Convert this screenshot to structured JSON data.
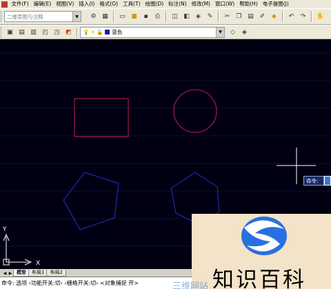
{
  "menu": {
    "items": [
      "文件(F)",
      "编辑(E)",
      "视图(V)",
      "插入(I)",
      "格式(O)",
      "工具(T)",
      "绘图(D)",
      "标注(N)",
      "修改(M)",
      "窗口(W)",
      "帮助(H)",
      "电子提图(J)"
    ]
  },
  "toolbar": {
    "workspace_combo": "二维草图与注释",
    "layer_combo": "蓝色"
  },
  "canvas": {
    "background": "#000012",
    "rectangle_color": "#c8204e",
    "circle_color": "#c8204e",
    "polygon_color": "#2a2ad0",
    "ucs_y_label": "Y",
    "ucs_x_label": "X"
  },
  "command_tip": {
    "label": "命令:"
  },
  "tabs": [
    {
      "label": "模型",
      "active": true
    },
    {
      "label": "布局1",
      "active": false
    },
    {
      "label": "布局2",
      "active": false
    }
  ],
  "command_line": {
    "text": "命令: 选项 ‹功能开关:切›  ‹栅格开关:切›  <对象捕捉 开>"
  },
  "watermark": {
    "text": "知识百科",
    "under_text": "三维网站"
  }
}
